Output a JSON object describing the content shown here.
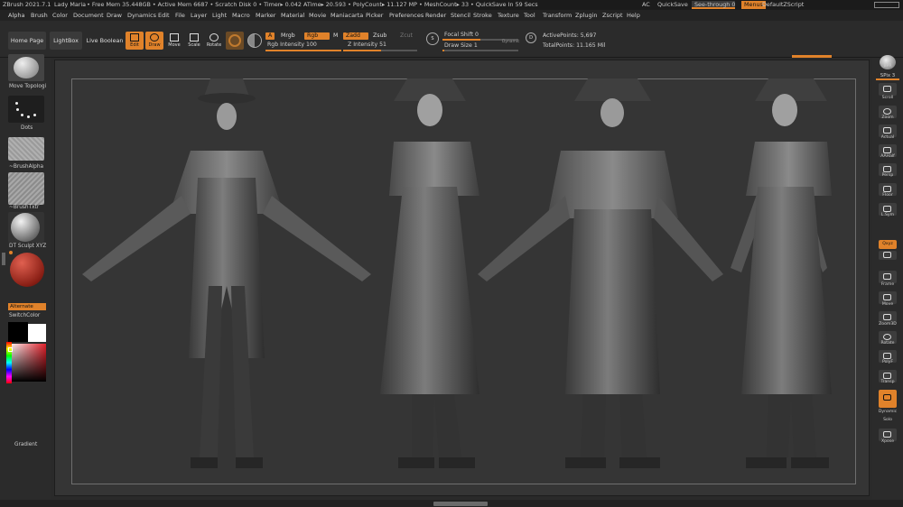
{
  "titlebar": {
    "app": "ZBrush 2021.7.1",
    "doc": "Lady Maria",
    "stats": ". • Free Mem 35.448GB • Active Mem 6687 • Scratch Disk 0 • Timer▸ 0.042 ATime▸ 20.593 • PolyCount▸ 11.127 MP • MeshCount▸ 33 • QuickSave In 59 Secs",
    "ac": "AC",
    "quicksave": "QuickSave",
    "see_through": "See-through",
    "see_through_value": "0",
    "menus": "Menus",
    "script": "DefaultZScript"
  },
  "menus": [
    "Alpha",
    "Brush",
    "Color",
    "Document",
    "Draw",
    "Dynamics",
    "Edit",
    "File",
    "Layer",
    "Light",
    "Macro",
    "Marker",
    "Material",
    "Movie",
    "Maniacarta",
    "Picker",
    "Preferences",
    "Render",
    "Stencil",
    "Stroke",
    "Texture",
    "Tool",
    "Transform",
    "Zplugin",
    "Zscript",
    "Help"
  ],
  "toolbar": {
    "home_page": "Home Page",
    "lightbox": "LightBox",
    "live_boolean": "Live Boolean",
    "edit": "Edit",
    "draw": "Draw",
    "move": "Move",
    "scale": "Scale",
    "rotate": "Rotate",
    "a": "A",
    "mrgb": "Mrgb",
    "rgb": "Rgb",
    "m": "M",
    "rgb_intensity_label": "Rgb Intensity",
    "rgb_intensity_value": "100",
    "zadd": "Zadd",
    "zsub": "Zsub",
    "zcut": "Zcut",
    "z_intensity_label": "Z Intensity",
    "z_intensity_value": "51",
    "s": "S",
    "d": "D",
    "focal_shift_label": "Focal Shift",
    "focal_shift_value": "0",
    "draw_size_label": "Draw Size",
    "draw_size_value": "1",
    "dynamic": "Dynamic",
    "active_points": "ActivePoints: 5,697",
    "total_points": "TotalPoints: 11.165 Mil"
  },
  "left": {
    "move_topology": "Move Topologi",
    "dots": "Dots",
    "brush_alpha": "~BrushAlpha",
    "brush_txtr": "~BrushTxtr",
    "material": "DT Sculpt XYZ",
    "alternate": "Alternate",
    "switch_color": "SwitchColor",
    "gradient": "Gradient"
  },
  "right": {
    "bpr": "BPR",
    "spix": "SPix 3",
    "items": [
      "Scroll",
      "Zoom",
      "Actual",
      "AAHalf",
      "Persp",
      "Floor",
      "L.Sym",
      "Qxyz",
      "",
      "Frame",
      "Move",
      "Zoom3D",
      "Rotate",
      "PolyF",
      "Transp",
      "Dynamic",
      "Solo",
      "Xpose"
    ]
  },
  "colors": {
    "accent": "#e0822a",
    "primary_color": "#000000",
    "secondary_color": "#ffffff"
  }
}
